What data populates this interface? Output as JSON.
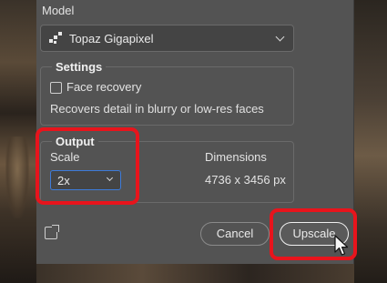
{
  "model": {
    "label": "Model",
    "selected": "Topaz Gigapixel"
  },
  "settings": {
    "title": "Settings",
    "face_recovery_label": "Face recovery",
    "face_recovery_checked": false,
    "hint": "Recovers detail in blurry or low-res faces"
  },
  "output": {
    "title": "Output",
    "scale_label": "Scale",
    "scale_value": "2x",
    "dimensions_label": "Dimensions",
    "dimensions_value": "4736 x 3456 px"
  },
  "buttons": {
    "cancel": "Cancel",
    "upscale": "Upscale"
  },
  "colors": {
    "panel": "#535353",
    "highlight": "#e8141c",
    "focus": "#3d7bd9"
  }
}
